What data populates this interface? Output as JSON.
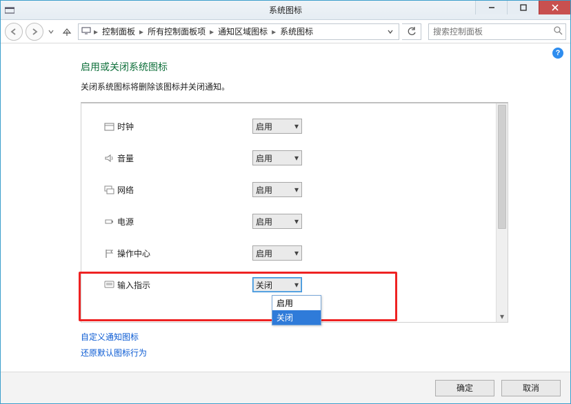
{
  "window": {
    "title": "系统图标"
  },
  "breadcrumb": {
    "items": [
      "控制面板",
      "所有控制面板项",
      "通知区域图标",
      "系统图标"
    ]
  },
  "search": {
    "placeholder": "搜索控制面板"
  },
  "page": {
    "heading": "启用或关闭系统图标",
    "subtext": "关闭系统图标将删除该图标并关闭通知。"
  },
  "rows": [
    {
      "icon": "clock-icon",
      "label": "时钟",
      "value": "启用"
    },
    {
      "icon": "volume-icon",
      "label": "音量",
      "value": "启用"
    },
    {
      "icon": "network-icon",
      "label": "网络",
      "value": "启用"
    },
    {
      "icon": "power-icon",
      "label": "电源",
      "value": "启用"
    },
    {
      "icon": "flag-icon",
      "label": "操作中心",
      "value": "启用"
    },
    {
      "icon": "ime-icon",
      "label": "输入指示",
      "value": "关闭"
    }
  ],
  "dropdown": {
    "options": [
      "启用",
      "关闭"
    ],
    "selected": "关闭"
  },
  "links": {
    "customize": "自定义通知图标",
    "restore": "还原默认图标行为"
  },
  "footer": {
    "ok": "确定",
    "cancel": "取消"
  },
  "help": {
    "glyph": "?"
  }
}
